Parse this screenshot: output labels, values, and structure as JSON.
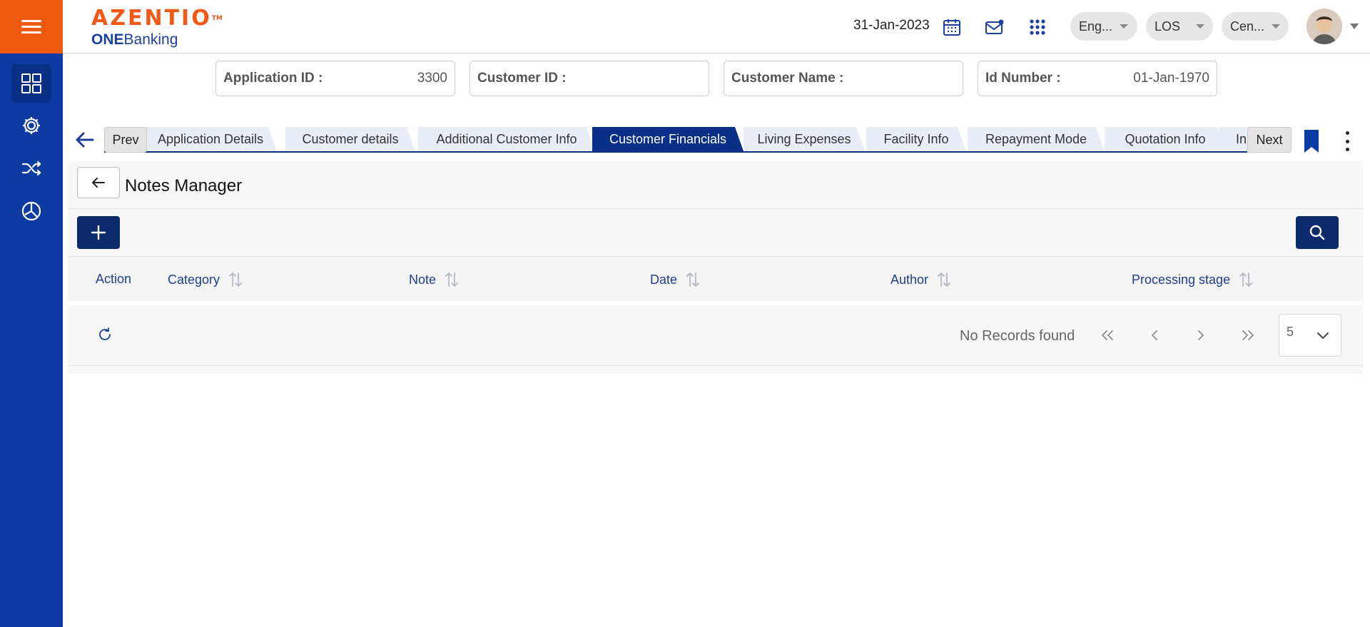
{
  "header": {
    "brand": "AZENTIO",
    "brand_tm": "TM",
    "sub_bold": "ONE",
    "sub_rest": "Banking",
    "date": "31-Jan-2023",
    "language": "Eng...",
    "module": "LOS",
    "branch": "Cen..."
  },
  "sidebar": {
    "items": [
      {
        "name": "dashboard-icon"
      },
      {
        "name": "settings-gear-icon"
      },
      {
        "name": "shuffle-icon"
      },
      {
        "name": "pie-chart-icon"
      }
    ]
  },
  "info_cards": [
    {
      "label": "Application ID :",
      "value": "3300"
    },
    {
      "label": "Customer ID :",
      "value": ""
    },
    {
      "label": "Customer Name :",
      "value": ""
    },
    {
      "label": "Id Number :",
      "value": "01-Jan-1970"
    }
  ],
  "tabs": {
    "prev": "Prev",
    "next": "Next",
    "items": [
      {
        "label": "Application Details"
      },
      {
        "label": "Customer details"
      },
      {
        "label": "Additional Customer Info"
      },
      {
        "label": "Customer Financials",
        "active": true
      },
      {
        "label": "Living Expenses"
      },
      {
        "label": "Facility Info"
      },
      {
        "label": "Repayment Mode"
      },
      {
        "label": "Quotation Info"
      },
      {
        "label": "In"
      }
    ]
  },
  "page": {
    "title": "Notes Manager"
  },
  "table": {
    "columns": [
      {
        "label": "Action"
      },
      {
        "label": "Category"
      },
      {
        "label": "Note"
      },
      {
        "label": "Date"
      },
      {
        "label": "Author"
      },
      {
        "label": "Processing stage"
      }
    ],
    "rows": []
  },
  "paginator": {
    "status": "No Records found",
    "page_size": "5"
  },
  "colors": {
    "nav_blue": "#0e3aa3",
    "accent_orange": "#ef5a13",
    "primary_dark": "#0a2a6d",
    "active_tab": "#0a2f86"
  }
}
